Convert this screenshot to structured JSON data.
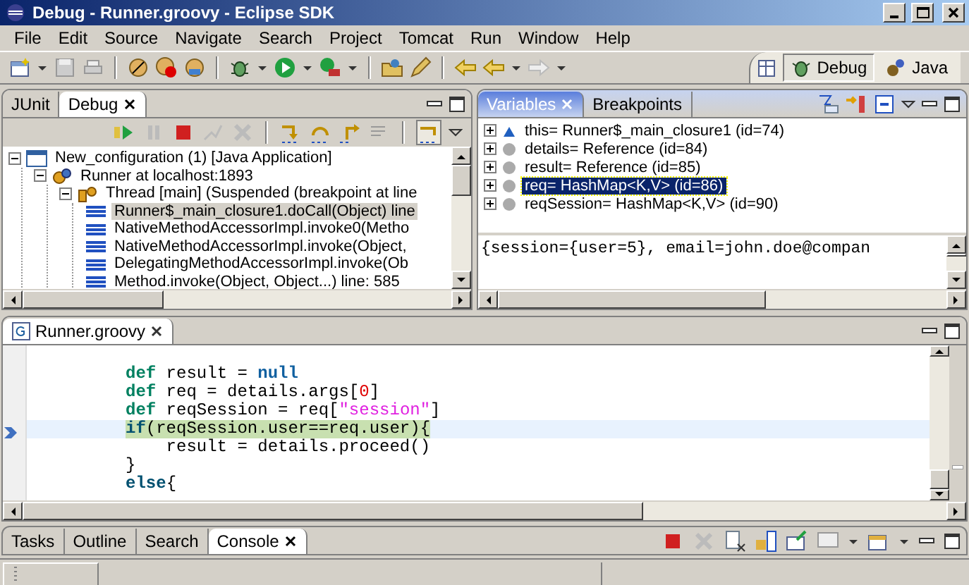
{
  "window": {
    "title": "Debug - Runner.groovy - Eclipse SDK"
  },
  "menu": [
    "File",
    "Edit",
    "Source",
    "Navigate",
    "Search",
    "Project",
    "Tomcat",
    "Run",
    "Window",
    "Help"
  ],
  "perspectives": [
    {
      "label": "Debug",
      "selected": true
    },
    {
      "label": "Java",
      "selected": false
    }
  ],
  "debug_panel": {
    "tabs": [
      {
        "label": "JUnit",
        "selected": false
      },
      {
        "label": "Debug",
        "selected": true
      }
    ],
    "tree": [
      {
        "kind": "launch",
        "label": "New_configuration (1) [Java Application]",
        "expanded": true,
        "selected": false,
        "children": [
          {
            "kind": "target",
            "label": "Runner at localhost:1893",
            "expanded": true,
            "selected": false,
            "children": [
              {
                "kind": "thread",
                "label": "Thread [main] (Suspended (breakpoint at line",
                "expanded": true,
                "selected": false,
                "children": [
                  {
                    "kind": "frame",
                    "label": "Runner$_main_closure1.doCall(Object) line",
                    "selected": true
                  },
                  {
                    "kind": "frame",
                    "label": "NativeMethodAccessorImpl.invoke0(Metho",
                    "selected": false
                  },
                  {
                    "kind": "frame",
                    "label": "NativeMethodAccessorImpl.invoke(Object,",
                    "selected": false
                  },
                  {
                    "kind": "frame",
                    "label": "DelegatingMethodAccessorImpl.invoke(Ob",
                    "selected": false
                  },
                  {
                    "kind": "frame",
                    "label": "Method.invoke(Object, Object...) line: 585",
                    "selected": false
                  }
                ]
              }
            ]
          }
        ]
      }
    ]
  },
  "variables_panel": {
    "tabs": [
      {
        "label": "Variables",
        "selected": true
      },
      {
        "label": "Breakpoints",
        "selected": false
      }
    ],
    "variables": [
      {
        "kind": "field",
        "label": "this= Runner$_main_closure1  (id=74)",
        "selected": false
      },
      {
        "kind": "local",
        "label": "details= Reference  (id=84)",
        "selected": false
      },
      {
        "kind": "local",
        "label": "result= Reference  (id=85)",
        "selected": false
      },
      {
        "kind": "local",
        "label": "req= HashMap<K,V>  (id=86)",
        "selected": true
      },
      {
        "kind": "local",
        "label": "reqSession= HashMap<K,V>  (id=90)",
        "selected": false
      }
    ],
    "detail": "{session={user=5}, email=john.doe@compan"
  },
  "editor": {
    "tab": {
      "label": "Runner.groovy",
      "selected": true
    },
    "lines": [
      {
        "current": false
      },
      {
        "current": false,
        "tokens": [
          {
            "kind": "keyword",
            "text": "def"
          },
          {
            "kind": "plain",
            "text": " result = "
          },
          {
            "kind": "constant",
            "text": "null"
          }
        ]
      },
      {
        "current": false,
        "tokens": [
          {
            "kind": "keyword",
            "text": "def"
          },
          {
            "kind": "plain",
            "text": " req = details.args["
          },
          {
            "kind": "number",
            "text": "0"
          },
          {
            "kind": "plain",
            "text": "]"
          }
        ]
      },
      {
        "current": false,
        "tokens": [
          {
            "kind": "keyword",
            "text": "def"
          },
          {
            "kind": "plain",
            "text": " reqSession = req["
          },
          {
            "kind": "string",
            "text": "\"session\""
          },
          {
            "kind": "plain",
            "text": "]"
          }
        ]
      },
      {
        "current": true,
        "tokens": [
          {
            "kind": "control",
            "text": "if"
          },
          {
            "kind": "plain",
            "text": "(reqSession.user==req.user){"
          }
        ]
      },
      {
        "current": false,
        "tokens": [
          {
            "kind": "plain",
            "text": "    result = details.proceed()"
          }
        ]
      },
      {
        "current": false,
        "tokens": [
          {
            "kind": "plain",
            "text": "}"
          }
        ]
      },
      {
        "current": false,
        "tokens": [
          {
            "kind": "control",
            "text": "else"
          },
          {
            "kind": "plain",
            "text": "{"
          }
        ]
      }
    ]
  },
  "bottom_panel": {
    "tabs": [
      {
        "label": "Tasks",
        "selected": false
      },
      {
        "label": "Outline",
        "selected": false
      },
      {
        "label": "Search",
        "selected": false
      },
      {
        "label": "Console",
        "selected": true
      }
    ]
  }
}
